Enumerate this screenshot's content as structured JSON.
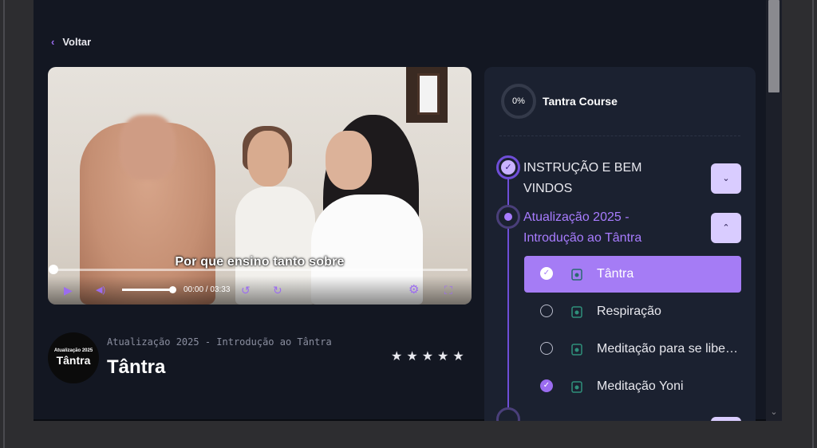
{
  "nav": {
    "back_label": "Voltar"
  },
  "video": {
    "subtitle": "Por que ensino tanto sobre",
    "time": "00:00 / 03:33"
  },
  "lesson": {
    "thumb_small": "Atualização 2025",
    "thumb_big": "Tântra",
    "module": "Atualização 2025 - Introdução ao Tântra",
    "title": "Tântra",
    "stars": "★★★★★"
  },
  "course": {
    "progress": "0%",
    "name": "Tantra Course",
    "sections": [
      {
        "title": "INSTRUÇÃO E BEM VINDOS",
        "expanded": false,
        "color": "#e8e8ee"
      },
      {
        "title": "Atualização 2025 - Introdução ao Tântra",
        "expanded": true,
        "color": "#a87cff",
        "lessons": [
          {
            "title": "Tântra",
            "completed": true,
            "active": true
          },
          {
            "title": "Respiração",
            "completed": false,
            "active": false
          },
          {
            "title": "Meditação para se libertar",
            "completed": false,
            "active": false
          },
          {
            "title": "Meditação Yoni",
            "completed": true,
            "active": false
          }
        ]
      }
    ]
  },
  "colors": {
    "accent": "#9b6cf0",
    "panel": "#1b2130",
    "background": "#131722"
  }
}
